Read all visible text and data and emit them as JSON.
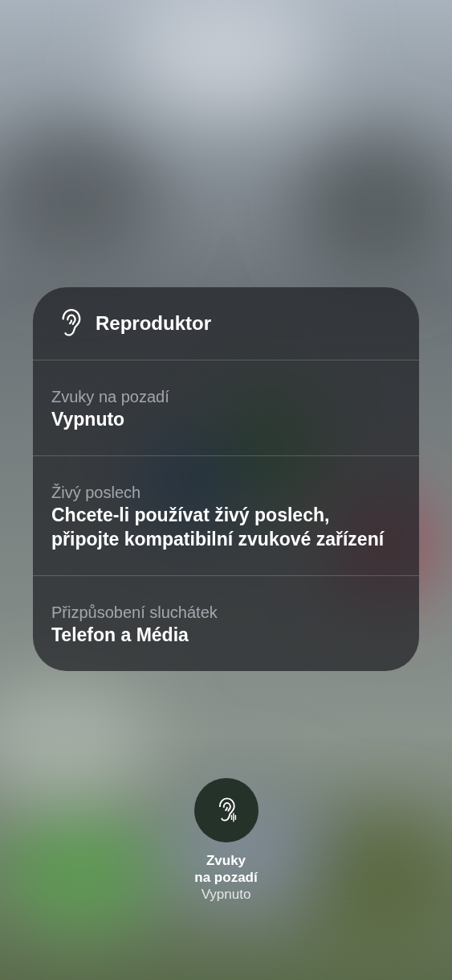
{
  "panel": {
    "title": "Reproduktor"
  },
  "rows": [
    {
      "label": "Zvuky na pozadí",
      "value": "Vypnuto"
    },
    {
      "label": "Živý poslech",
      "value": "Chcete-li používat živý poslech, připojte kompatibilní zvukové zařízení"
    },
    {
      "label": "Přizpůsobení sluchátek",
      "value": "Telefon a Média"
    }
  ],
  "toggle": {
    "label_lines": [
      "Zvuky",
      "na pozadí"
    ],
    "status": "Vypnuto",
    "on": false
  }
}
